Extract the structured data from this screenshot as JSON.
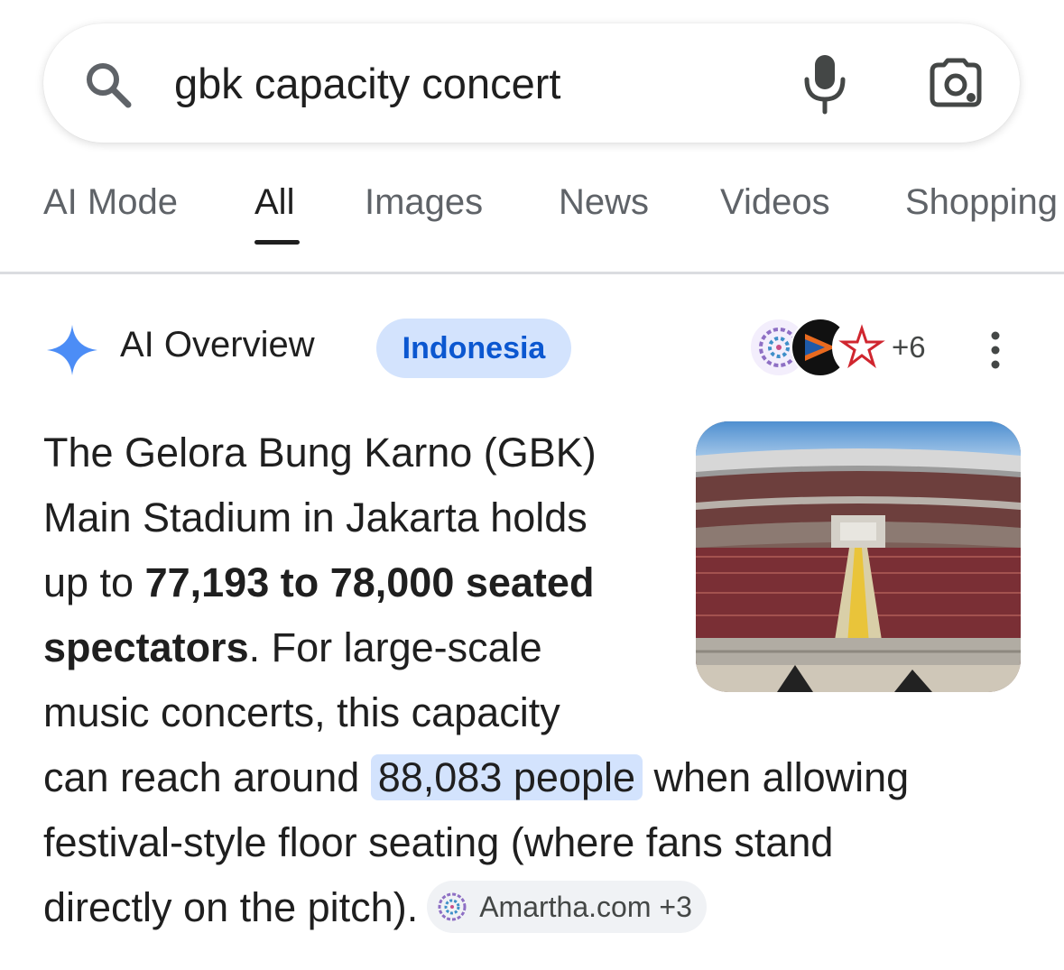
{
  "search": {
    "query": "gbk capacity concert",
    "icons": [
      "search-icon",
      "microphone-icon",
      "google-lens-icon"
    ]
  },
  "tabs": [
    {
      "label": "AI Mode",
      "active": false
    },
    {
      "label": "All",
      "active": true
    },
    {
      "label": "Images",
      "active": false
    },
    {
      "label": "News",
      "active": false
    },
    {
      "label": "Videos",
      "active": false
    },
    {
      "label": "Shopping",
      "active": false
    }
  ],
  "ai_overview": {
    "title": "AI Overview",
    "region_chip": "Indonesia",
    "sources_more": "+6",
    "body": {
      "l1": "The Gelora Bung Karno (GBK)",
      "l2": "Main Stadium in Jakarta holds",
      "l3_pre": "up to ",
      "l3_bold": "77,193 to 78,000 seated",
      "l4_bold": "spectators",
      "l4_rest": ". For large-scale",
      "l5": "music concerts, this capacity",
      "l6_pre": "can reach around ",
      "l6_highlight": "88,083 people",
      "l6_post": " when allowing",
      "l7": "festival-style floor seating (where fans stand",
      "l8": "directly on the pitch)."
    },
    "citation": "Amartha.com +3"
  },
  "colors": {
    "accent_blue": "#0b57d0",
    "chip_blue": "#d3e3fd",
    "sparkle_blue": "#4c8df6",
    "text": "#1f1f1f",
    "muted": "#5f6368"
  }
}
